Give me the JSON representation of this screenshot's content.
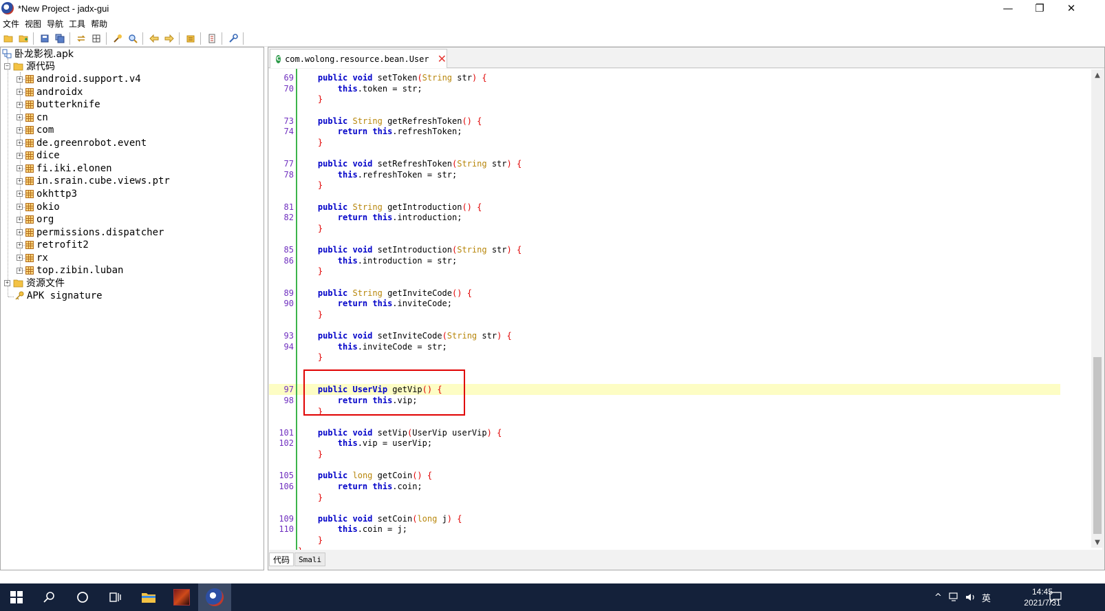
{
  "window": {
    "title": "*New Project - jadx-gui",
    "controls": [
      "—",
      "❐",
      "✕"
    ]
  },
  "menu": {
    "items": [
      "文件",
      "视图",
      "导航",
      "工具",
      "帮助"
    ]
  },
  "toolbar": {
    "icons": [
      "open-folder-icon",
      "add-files-icon",
      "save-icon",
      "save-all-icon",
      "sync-icon",
      "expand-tree-icon",
      "decompile-icon",
      "search-icon",
      "back-icon",
      "forward-icon",
      "log-icon",
      "preferences-icon",
      "tools-icon"
    ]
  },
  "tree": {
    "root": "卧龙影视.apk",
    "source_folder": "源代码",
    "packages": [
      "android.support.v4",
      "androidx",
      "butterknife",
      "cn",
      "com",
      "de.greenrobot.event",
      "dice",
      "fi.iki.elonen",
      "in.srain.cube.views.ptr",
      "okhttp3",
      "okio",
      "org",
      "permissions.dispatcher",
      "retrofit2",
      "rx",
      "top.zibin.luban"
    ],
    "resources_folder": "资源文件",
    "signature": "APK signature"
  },
  "editor": {
    "tab_title": "com.wolong.resource.bean.User",
    "bottom_tabs": [
      "代码",
      "Smali"
    ],
    "highlighted_line": "97",
    "lines": [
      {
        "n": "69",
        "t": [
          [
            "    ",
            ""
          ],
          [
            "public",
            "kw"
          ],
          [
            " ",
            ""
          ],
          [
            "void",
            "kw"
          ],
          [
            " setToken",
            "id"
          ],
          [
            "(",
            "br"
          ],
          [
            "String",
            "ty"
          ],
          [
            " str",
            "id"
          ],
          [
            ")",
            "br"
          ],
          [
            " ",
            ""
          ],
          [
            "{",
            "br"
          ]
        ]
      },
      {
        "n": "70",
        "t": [
          [
            "        ",
            ""
          ],
          [
            "this",
            "kw"
          ],
          [
            ".token = str;",
            "id"
          ]
        ]
      },
      {
        "n": "",
        "t": [
          [
            "    ",
            ""
          ],
          [
            "}",
            "br"
          ]
        ]
      },
      {
        "n": "",
        "t": []
      },
      {
        "n": "73",
        "t": [
          [
            "    ",
            ""
          ],
          [
            "public",
            "kw"
          ],
          [
            " ",
            ""
          ],
          [
            "String",
            "ty"
          ],
          [
            " getRefreshToken",
            "id"
          ],
          [
            "()",
            "br"
          ],
          [
            " ",
            ""
          ],
          [
            "{",
            "br"
          ]
        ]
      },
      {
        "n": "74",
        "t": [
          [
            "        ",
            ""
          ],
          [
            "return",
            "kw"
          ],
          [
            " ",
            ""
          ],
          [
            "this",
            "kw"
          ],
          [
            ".refreshToken;",
            "id"
          ]
        ]
      },
      {
        "n": "",
        "t": [
          [
            "    ",
            ""
          ],
          [
            "}",
            "br"
          ]
        ]
      },
      {
        "n": "",
        "t": []
      },
      {
        "n": "77",
        "t": [
          [
            "    ",
            ""
          ],
          [
            "public",
            "kw"
          ],
          [
            " ",
            ""
          ],
          [
            "void",
            "kw"
          ],
          [
            " setRefreshToken",
            "id"
          ],
          [
            "(",
            "br"
          ],
          [
            "String",
            "ty"
          ],
          [
            " str",
            "id"
          ],
          [
            ")",
            "br"
          ],
          [
            " ",
            ""
          ],
          [
            "{",
            "br"
          ]
        ]
      },
      {
        "n": "78",
        "t": [
          [
            "        ",
            ""
          ],
          [
            "this",
            "kw"
          ],
          [
            ".refreshToken = str;",
            "id"
          ]
        ]
      },
      {
        "n": "",
        "t": [
          [
            "    ",
            ""
          ],
          [
            "}",
            "br"
          ]
        ]
      },
      {
        "n": "",
        "t": []
      },
      {
        "n": "81",
        "t": [
          [
            "    ",
            ""
          ],
          [
            "public",
            "kw"
          ],
          [
            " ",
            ""
          ],
          [
            "String",
            "ty"
          ],
          [
            " getIntroduction",
            "id"
          ],
          [
            "()",
            "br"
          ],
          [
            " ",
            ""
          ],
          [
            "{",
            "br"
          ]
        ]
      },
      {
        "n": "82",
        "t": [
          [
            "        ",
            ""
          ],
          [
            "return",
            "kw"
          ],
          [
            " ",
            ""
          ],
          [
            "this",
            "kw"
          ],
          [
            ".introduction;",
            "id"
          ]
        ]
      },
      {
        "n": "",
        "t": [
          [
            "    ",
            ""
          ],
          [
            "}",
            "br"
          ]
        ]
      },
      {
        "n": "",
        "t": []
      },
      {
        "n": "85",
        "t": [
          [
            "    ",
            ""
          ],
          [
            "public",
            "kw"
          ],
          [
            " ",
            ""
          ],
          [
            "void",
            "kw"
          ],
          [
            " setIntroduction",
            "id"
          ],
          [
            "(",
            "br"
          ],
          [
            "String",
            "ty"
          ],
          [
            " str",
            "id"
          ],
          [
            ")",
            "br"
          ],
          [
            " ",
            ""
          ],
          [
            "{",
            "br"
          ]
        ]
      },
      {
        "n": "86",
        "t": [
          [
            "        ",
            ""
          ],
          [
            "this",
            "kw"
          ],
          [
            ".introduction = str;",
            "id"
          ]
        ]
      },
      {
        "n": "",
        "t": [
          [
            "    ",
            ""
          ],
          [
            "}",
            "br"
          ]
        ]
      },
      {
        "n": "",
        "t": []
      },
      {
        "n": "89",
        "t": [
          [
            "    ",
            ""
          ],
          [
            "public",
            "kw"
          ],
          [
            " ",
            ""
          ],
          [
            "String",
            "ty"
          ],
          [
            " getInviteCode",
            "id"
          ],
          [
            "()",
            "br"
          ],
          [
            " ",
            ""
          ],
          [
            "{",
            "br"
          ]
        ]
      },
      {
        "n": "90",
        "t": [
          [
            "        ",
            ""
          ],
          [
            "return",
            "kw"
          ],
          [
            " ",
            ""
          ],
          [
            "this",
            "kw"
          ],
          [
            ".inviteCode;",
            "id"
          ]
        ]
      },
      {
        "n": "",
        "t": [
          [
            "    ",
            ""
          ],
          [
            "}",
            "br"
          ]
        ]
      },
      {
        "n": "",
        "t": []
      },
      {
        "n": "93",
        "t": [
          [
            "    ",
            ""
          ],
          [
            "public",
            "kw"
          ],
          [
            " ",
            ""
          ],
          [
            "void",
            "kw"
          ],
          [
            " setInviteCode",
            "id"
          ],
          [
            "(",
            "br"
          ],
          [
            "String",
            "ty"
          ],
          [
            " str",
            "id"
          ],
          [
            ")",
            "br"
          ],
          [
            " ",
            ""
          ],
          [
            "{",
            "br"
          ]
        ]
      },
      {
        "n": "94",
        "t": [
          [
            "        ",
            ""
          ],
          [
            "this",
            "kw"
          ],
          [
            ".inviteCode = str;",
            "id"
          ]
        ]
      },
      {
        "n": "",
        "t": [
          [
            "    ",
            ""
          ],
          [
            "}",
            "br"
          ]
        ]
      },
      {
        "n": "",
        "t": []
      },
      {
        "n": "",
        "t": []
      },
      {
        "n": "97",
        "t": [
          [
            "    ",
            ""
          ],
          [
            "public",
            "kw"
          ],
          [
            " ",
            ""
          ],
          [
            "UserVip",
            "kw"
          ],
          [
            " getVip",
            "id"
          ],
          [
            "()",
            "br"
          ],
          [
            " ",
            ""
          ],
          [
            "{",
            "br"
          ]
        ]
      },
      {
        "n": "98",
        "t": [
          [
            "        ",
            ""
          ],
          [
            "return",
            "kw"
          ],
          [
            " ",
            ""
          ],
          [
            "this",
            "kw"
          ],
          [
            ".vip;",
            "id"
          ]
        ]
      },
      {
        "n": "",
        "t": [
          [
            "    ",
            ""
          ],
          [
            "}",
            "br"
          ]
        ]
      },
      {
        "n": "",
        "t": []
      },
      {
        "n": "101",
        "t": [
          [
            "    ",
            ""
          ],
          [
            "public",
            "kw"
          ],
          [
            " ",
            ""
          ],
          [
            "void",
            "kw"
          ],
          [
            " setVip",
            "id"
          ],
          [
            "(",
            "br"
          ],
          [
            "UserVip userVip",
            "id"
          ],
          [
            ")",
            "br"
          ],
          [
            " ",
            ""
          ],
          [
            "{",
            "br"
          ]
        ]
      },
      {
        "n": "102",
        "t": [
          [
            "        ",
            ""
          ],
          [
            "this",
            "kw"
          ],
          [
            ".vip = userVip;",
            "id"
          ]
        ]
      },
      {
        "n": "",
        "t": [
          [
            "    ",
            ""
          ],
          [
            "}",
            "br"
          ]
        ]
      },
      {
        "n": "",
        "t": []
      },
      {
        "n": "105",
        "t": [
          [
            "    ",
            ""
          ],
          [
            "public",
            "kw"
          ],
          [
            " ",
            ""
          ],
          [
            "long",
            "ty"
          ],
          [
            " getCoin",
            "id"
          ],
          [
            "()",
            "br"
          ],
          [
            " ",
            ""
          ],
          [
            "{",
            "br"
          ]
        ]
      },
      {
        "n": "106",
        "t": [
          [
            "        ",
            ""
          ],
          [
            "return",
            "kw"
          ],
          [
            " ",
            ""
          ],
          [
            "this",
            "kw"
          ],
          [
            ".coin;",
            "id"
          ]
        ]
      },
      {
        "n": "",
        "t": [
          [
            "    ",
            ""
          ],
          [
            "}",
            "br"
          ]
        ]
      },
      {
        "n": "",
        "t": []
      },
      {
        "n": "109",
        "t": [
          [
            "    ",
            ""
          ],
          [
            "public",
            "kw"
          ],
          [
            " ",
            ""
          ],
          [
            "void",
            "kw"
          ],
          [
            " setCoin",
            "id"
          ],
          [
            "(",
            "br"
          ],
          [
            "long",
            "ty"
          ],
          [
            " j",
            "id"
          ],
          [
            ")",
            "br"
          ],
          [
            " ",
            ""
          ],
          [
            "{",
            "br"
          ]
        ]
      },
      {
        "n": "110",
        "t": [
          [
            "        ",
            ""
          ],
          [
            "this",
            "kw"
          ],
          [
            ".coin = j;",
            "id"
          ]
        ]
      },
      {
        "n": "",
        "t": [
          [
            "    ",
            ""
          ],
          [
            "}",
            "br"
          ]
        ]
      },
      {
        "n": "",
        "t": [
          [
            "}",
            "br"
          ]
        ]
      }
    ]
  },
  "taskbar": {
    "icons": [
      "windows-start-icon",
      "search-icon",
      "cortana-icon",
      "task-view-icon",
      "file-explorer-icon",
      "game-app-icon",
      "jadx-app-icon"
    ],
    "tray_lang": "英",
    "time": "14:45",
    "date": "2021/7/31"
  },
  "colors": {
    "keyword": "#0000c8",
    "type": "#b8860b",
    "bracket": "#e00000",
    "line_number": "#6f2fbf",
    "highlight_row": "#fdfdc4",
    "gutter_green": "#3cb44b",
    "annotation_box": "#e00000",
    "taskbar_bg": "#14213a"
  }
}
